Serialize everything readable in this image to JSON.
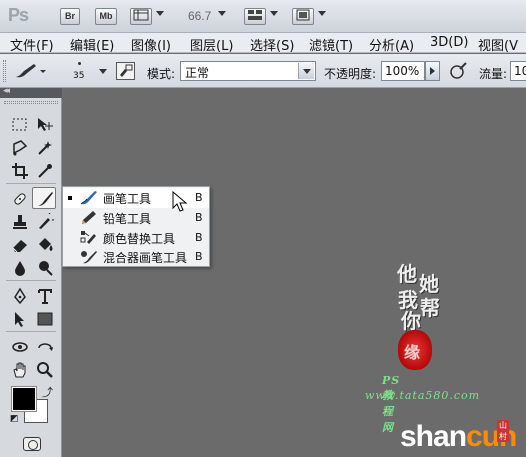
{
  "app": {
    "logo": "Ps",
    "buttons": [
      "Br",
      "Mb"
    ],
    "zoom": "66.7"
  },
  "menubar": {
    "items": [
      "文件(F)",
      "编辑(E)",
      "图像(I)",
      "图层(L)",
      "选择(S)",
      "滤镜(T)",
      "分析(A)",
      "3D(D)",
      "视图(V"
    ]
  },
  "options": {
    "brush_size": "35",
    "mode_label": "模式:",
    "mode_value": "正常",
    "opacity_label": "不透明度:",
    "opacity_value": "100%",
    "flow_label": "流量:",
    "flow_value": "10"
  },
  "toolbox": {
    "collapse_arrows": "◂◂"
  },
  "flyout": {
    "items": [
      {
        "label": "画笔工具",
        "shortcut": "B",
        "icon": "brush-icon",
        "selected": true
      },
      {
        "label": "铅笔工具",
        "shortcut": "B",
        "icon": "pencil-icon",
        "selected": false
      },
      {
        "label": "颜色替换工具",
        "shortcut": "B",
        "icon": "color-replacement-icon",
        "selected": false
      },
      {
        "label": "混合器画笔工具",
        "shortcut": "B",
        "icon": "mixer-brush-icon",
        "selected": false
      }
    ]
  },
  "watermark": {
    "calligraphy": [
      "他",
      "她",
      "我",
      "帮",
      "你"
    ],
    "seal": "缘",
    "line1": "PS教程网",
    "line2": "www.tata580.com",
    "brand_part1": "shan",
    "brand_part2": "cun",
    "brand_tag": "山村"
  },
  "colors": {
    "canvas": "#6b6b6b",
    "foreground": "#000000",
    "background": "#ffffff",
    "brand_orange": "#ff8c00",
    "watermark_green": "#7be08a"
  }
}
